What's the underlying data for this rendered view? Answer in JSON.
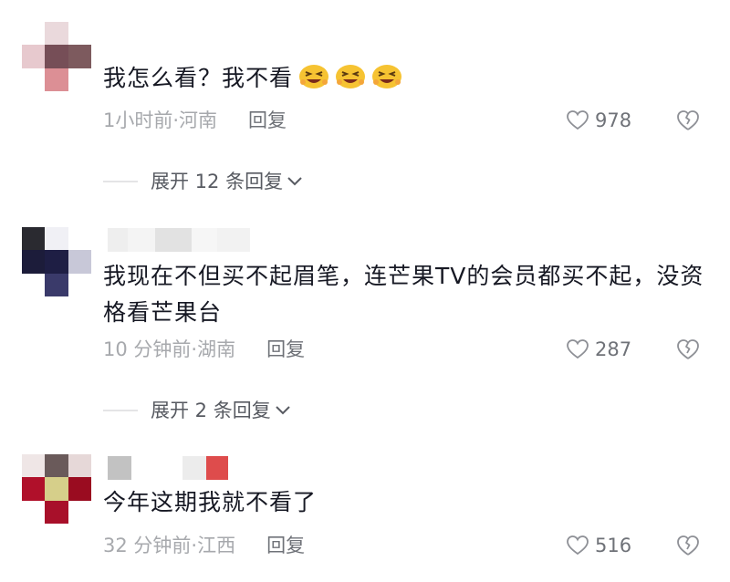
{
  "comments": [
    {
      "text": "我怎么看？我不看",
      "time_location": "1小时前·河南",
      "reply_label": "回复",
      "likes": "978",
      "expand_label": "展开 12 条回复"
    },
    {
      "text": "我现在不但买不起眉笔，连芒果TV的会员都买不起，没资格看芒果台",
      "time_location": "10 分钟前·湖南",
      "reply_label": "回复",
      "likes": "287",
      "expand_label": "展开 2 条回复"
    },
    {
      "text": "今年这期我就不看了",
      "time_location": "32 分钟前·江西",
      "reply_label": "回复",
      "likes": "516"
    }
  ],
  "icons": {
    "emoji": "grinning-wink-emoji",
    "like": "heart-outline-icon",
    "dislike": "broken-heart-icon",
    "expand": "chevron-down-icon"
  },
  "colors": {
    "text": "#161823",
    "meta": "#a7a9ad",
    "reply": "#6f7278",
    "emoji_face": "#f6c332"
  }
}
